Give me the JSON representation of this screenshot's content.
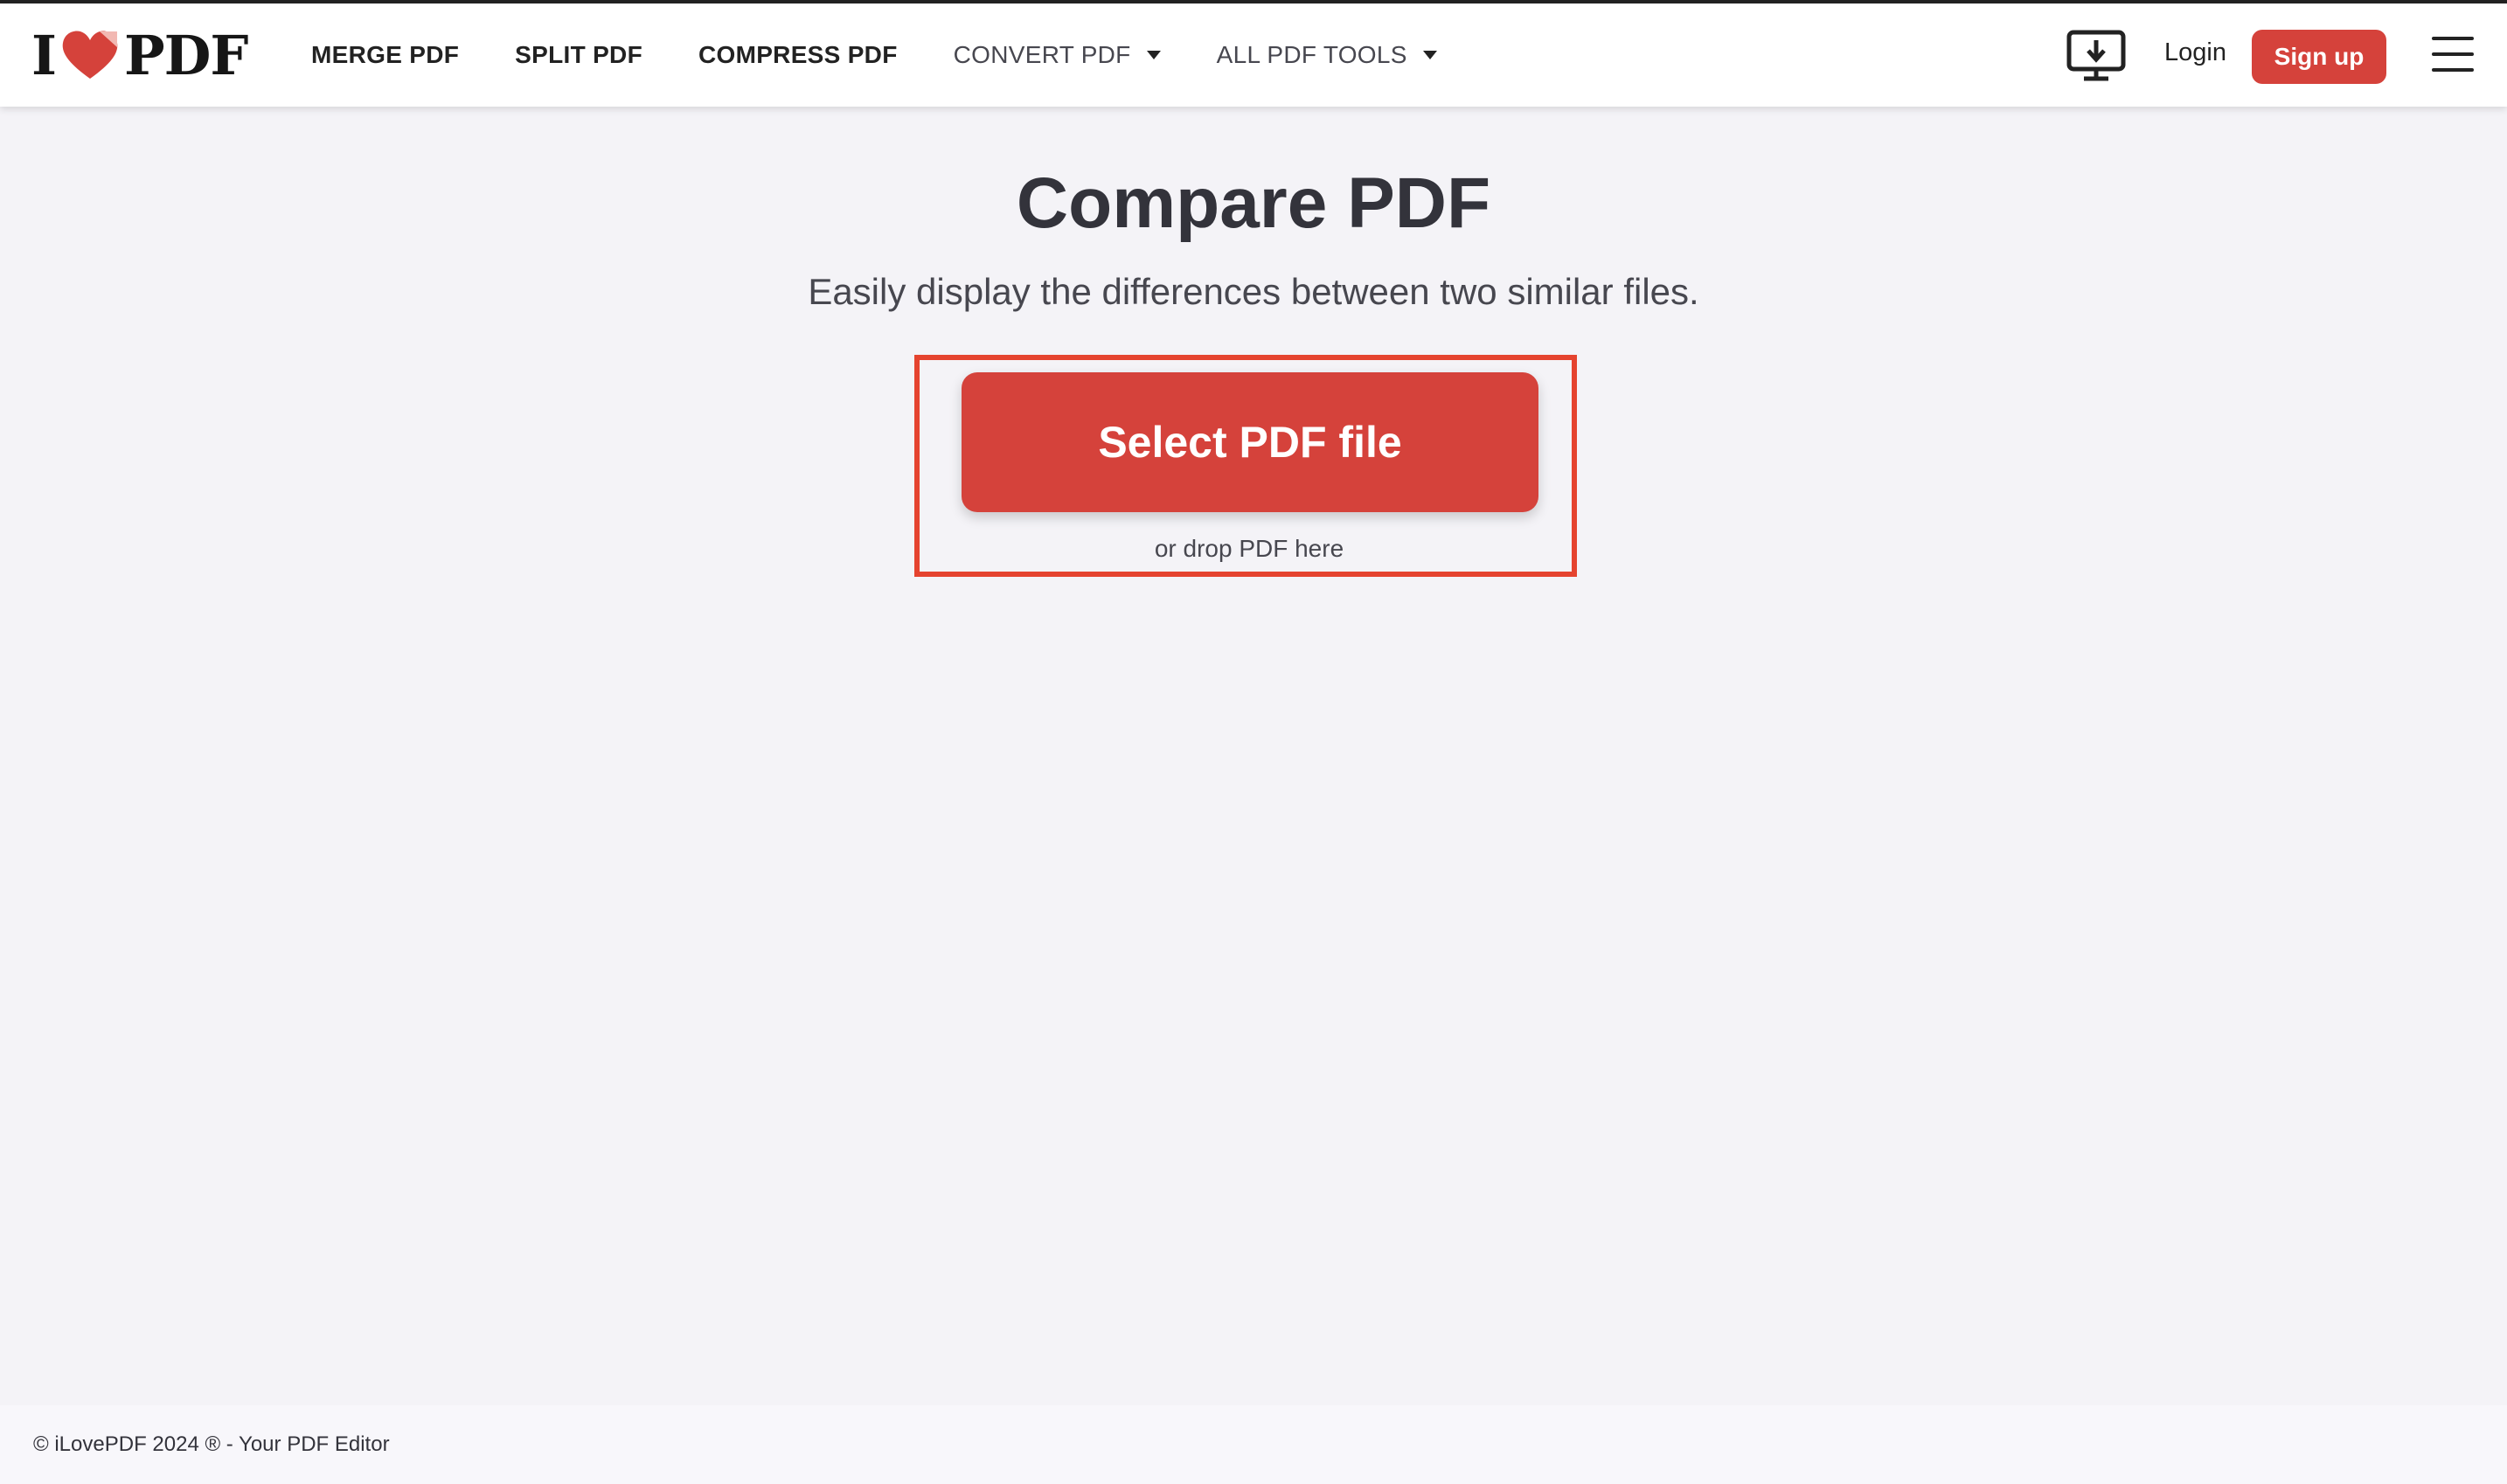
{
  "brand": {
    "logo_left": "I",
    "logo_right": "PDF",
    "accent_color": "#d5423b"
  },
  "nav": {
    "items": [
      {
        "label": "MERGE PDF",
        "dropdown": false
      },
      {
        "label": "SPLIT PDF",
        "dropdown": false
      },
      {
        "label": "COMPRESS PDF",
        "dropdown": false
      },
      {
        "label": "CONVERT PDF",
        "dropdown": true
      },
      {
        "label": "ALL PDF TOOLS",
        "dropdown": true
      }
    ]
  },
  "header_actions": {
    "desktop_icon": "desktop-download-icon",
    "login_label": "Login",
    "signup_label": "Sign up",
    "menu_icon": "hamburger-menu-icon"
  },
  "main": {
    "title": "Compare PDF",
    "subtitle": "Easily display the differences between two similar files.",
    "select_button_label": "Select PDF file",
    "drop_hint": "or drop PDF here",
    "highlight_color": "#e5432f"
  },
  "footer": {
    "text": "© iLovePDF 2024 ® - Your PDF Editor"
  }
}
